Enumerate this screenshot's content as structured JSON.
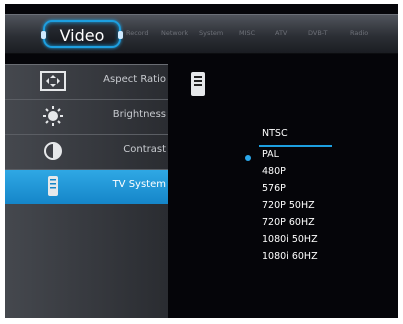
{
  "topbar": {
    "active_tab": "Video",
    "tabs": [
      "Record",
      "Network",
      "System",
      "MISC",
      "ATV",
      "DVB-T",
      "Radio"
    ]
  },
  "sidebar": {
    "items": [
      {
        "label": "Aspect Ratio",
        "icon": "aspect-ratio-icon"
      },
      {
        "label": "Brightness",
        "icon": "brightness-icon"
      },
      {
        "label": "Contrast",
        "icon": "contrast-icon"
      },
      {
        "label": "TV System",
        "icon": "tv-system-icon",
        "selected": true
      }
    ]
  },
  "options": {
    "items": [
      "NTSC",
      "PAL",
      "480P",
      "576P",
      "720P 50HZ",
      "720P 60HZ",
      "1080i 50HZ",
      "1080i 60HZ"
    ],
    "highlighted": "NTSC",
    "current": "PAL"
  },
  "colors": {
    "accent": "#1d9fe0",
    "background": "#050509",
    "panel": "#3a3d42"
  }
}
